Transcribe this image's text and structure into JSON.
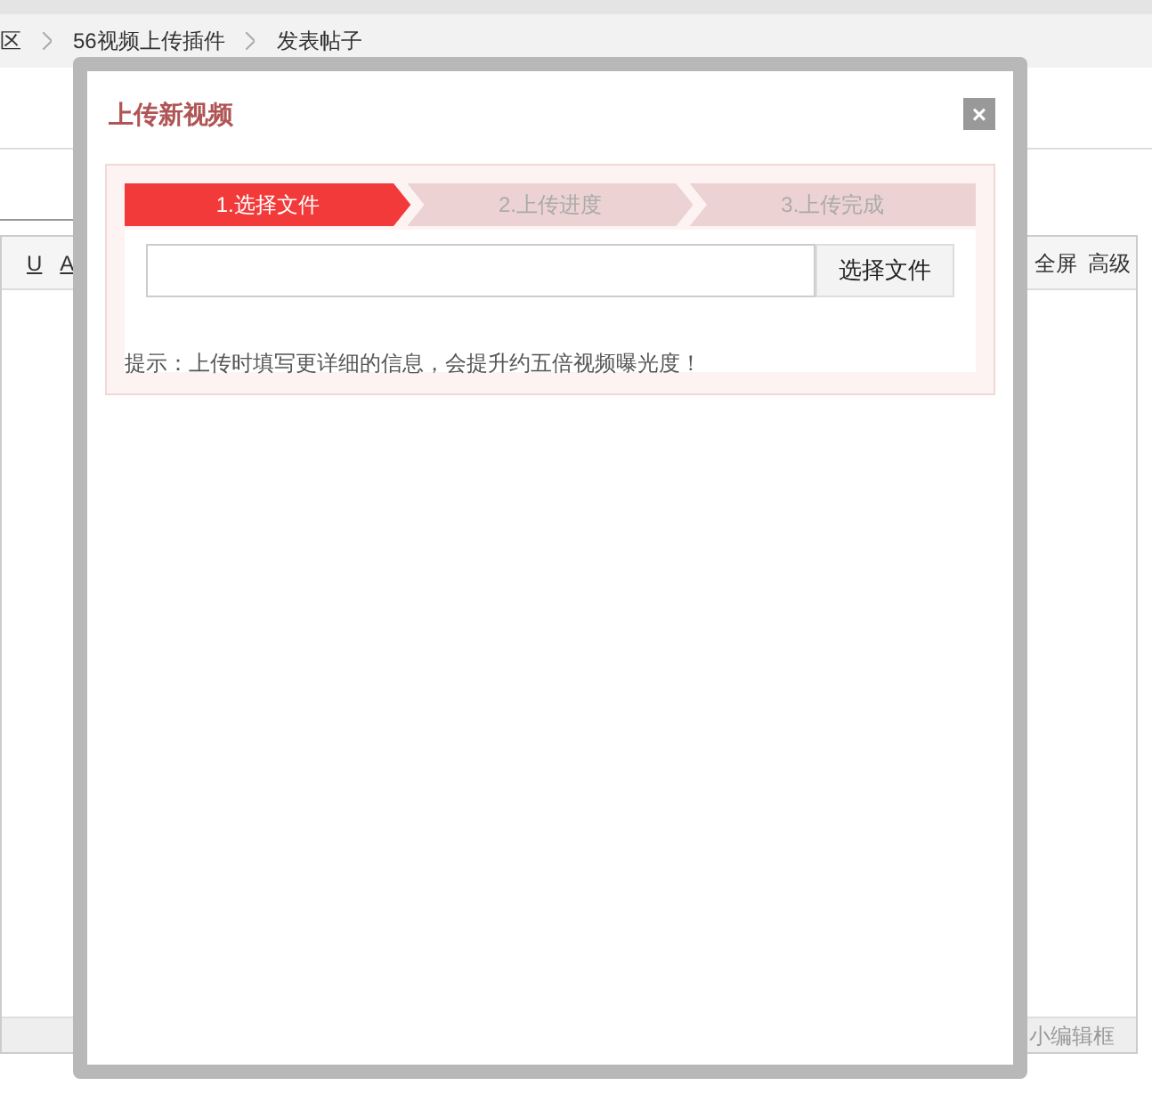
{
  "breadcrumb": [
    "区",
    "56视频上传插件",
    "发表帖子"
  ],
  "editor": {
    "toolbar_left": [
      "U",
      "A"
    ],
    "toolbar_right": [
      "全屏",
      "高级"
    ],
    "footer": "小编辑框"
  },
  "dialog": {
    "title": "上传新视频",
    "close": "×",
    "steps": [
      {
        "label": "1.选择文件",
        "selected": true
      },
      {
        "label": "2.上传进度",
        "selected": false
      },
      {
        "label": "3.上传完成",
        "selected": false
      }
    ],
    "file_button": "选择文件",
    "hint": "提示：上传时填写更详细的信息，会提升约五倍视频曝光度！"
  }
}
